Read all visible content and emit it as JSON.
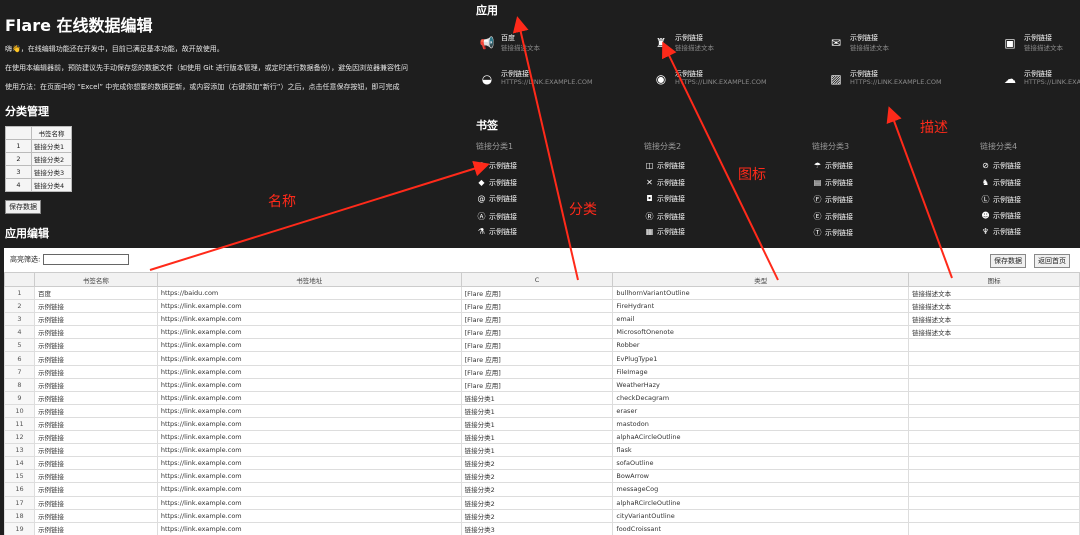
{
  "page": {
    "title": "Flare 在线数据编辑",
    "intro1": "嗨👋，在线编辑功能还在开发中，目前已满足基本功能，故开放使用。",
    "intro2": "在使用本编辑器前，预防建议先手动保存您的数据文件（如使用 Git 进行版本管理，或定时进行数据备份），避免因浏览器兼容性问",
    "intro3": "使用方法：在页面中的 “Excel” 中完成你想要的数据更新，或内容添加（右键添加“新行”）之后，点击任意保存按钮，即可完成"
  },
  "category_manage": {
    "title": "分类管理",
    "header": "书签名称",
    "rows": [
      {
        "idx": "1",
        "name": "链接分类1"
      },
      {
        "idx": "2",
        "name": "链接分类2"
      },
      {
        "idx": "3",
        "name": "链接分类3"
      },
      {
        "idx": "4",
        "name": "链接分类4"
      }
    ],
    "save_label": "保存数据"
  },
  "app_edit": {
    "title": "应用编辑"
  },
  "apps": {
    "title": "应用",
    "items": [
      {
        "name": "百度",
        "desc": "链接描述文本",
        "icon": "bullhorn-icon",
        "glyph": "📢"
      },
      {
        "name": "示例链接",
        "desc": "链接描述文本",
        "icon": "fire-hydrant-icon",
        "glyph": "♜"
      },
      {
        "name": "示例链接",
        "desc": "链接描述文本",
        "icon": "email-icon",
        "glyph": "✉"
      },
      {
        "name": "示例链接",
        "desc": "链接描述文本",
        "icon": "onenote-icon",
        "glyph": "▣"
      },
      {
        "name": "示例链接",
        "desc": "HTTPS://LINK.EXAMPLE.COM",
        "icon": "robber-icon",
        "glyph": "◒"
      },
      {
        "name": "示例链接",
        "desc": "HTTPS://LINK.EXAMPLE.COM",
        "icon": "plug-icon",
        "glyph": "◉"
      },
      {
        "name": "示例链接",
        "desc": "HTTPS://LINK.EXAMPLE.COM",
        "icon": "file-image-icon",
        "glyph": "▨"
      },
      {
        "name": "示例链接",
        "desc": "HTTPS://LINK.EXAMPLE.COM",
        "icon": "weather-hazy-icon",
        "glyph": "☁"
      }
    ]
  },
  "bookmarks": {
    "title": "书签",
    "columns": [
      {
        "name": "链接分类1",
        "items": [
          {
            "label": "示例链接",
            "glyph": "✺"
          },
          {
            "label": "示例链接",
            "glyph": "◆"
          },
          {
            "label": "示例链接",
            "glyph": "@"
          },
          {
            "label": "示例链接",
            "glyph": "Ⓐ"
          },
          {
            "label": "示例链接",
            "glyph": "⚗"
          }
        ]
      },
      {
        "name": "链接分类2",
        "items": [
          {
            "label": "示例链接",
            "glyph": "◫"
          },
          {
            "label": "示例链接",
            "glyph": "✕"
          },
          {
            "label": "示例链接",
            "glyph": "◘"
          },
          {
            "label": "示例链接",
            "glyph": "Ⓡ"
          },
          {
            "label": "示例链接",
            "glyph": "▦"
          }
        ]
      },
      {
        "name": "链接分类3",
        "items": [
          {
            "label": "示例链接",
            "glyph": "☂"
          },
          {
            "label": "示例链接",
            "glyph": "▤"
          },
          {
            "label": "示例链接",
            "glyph": "Ⓕ"
          },
          {
            "label": "示例链接",
            "glyph": "Ⓔ"
          },
          {
            "label": "示例链接",
            "glyph": "Ⓣ"
          }
        ]
      },
      {
        "name": "链接分类4",
        "items": [
          {
            "label": "示例链接",
            "glyph": "⊘"
          },
          {
            "label": "示例链接",
            "glyph": "♞"
          },
          {
            "label": "示例链接",
            "glyph": "Ⓛ"
          },
          {
            "label": "示例链接",
            "glyph": "☻"
          },
          {
            "label": "示例链接",
            "glyph": "♆"
          }
        ]
      }
    ]
  },
  "editor": {
    "filter_label": "高亮筛选:",
    "filter_value": "",
    "save_label": "保存数据",
    "home_label": "返回首页",
    "columns": [
      "书签名称",
      "书签地址",
      "C",
      "类型",
      "图标"
    ],
    "rows": [
      [
        "1",
        "百度",
        "https://baidu.com",
        "[Flare 应用]",
        "bullhornVariantOutline",
        "链接描述文本"
      ],
      [
        "2",
        "示例链接",
        "https://link.example.com",
        "[Flare 应用]",
        "FireHydrant",
        "链接描述文本"
      ],
      [
        "3",
        "示例链接",
        "https://link.example.com",
        "[Flare 应用]",
        "email",
        "链接描述文本"
      ],
      [
        "4",
        "示例链接",
        "https://link.example.com",
        "[Flare 应用]",
        "MicrosoftOnenote",
        "链接描述文本"
      ],
      [
        "5",
        "示例链接",
        "https://link.example.com",
        "[Flare 应用]",
        "Robber",
        ""
      ],
      [
        "6",
        "示例链接",
        "https://link.example.com",
        "[Flare 应用]",
        "EvPlugType1",
        ""
      ],
      [
        "7",
        "示例链接",
        "https://link.example.com",
        "[Flare 应用]",
        "FileImage",
        ""
      ],
      [
        "8",
        "示例链接",
        "https://link.example.com",
        "[Flare 应用]",
        "WeatherHazy",
        ""
      ],
      [
        "9",
        "示例链接",
        "https://link.example.com",
        "链接分类1",
        "checkDecagram",
        ""
      ],
      [
        "10",
        "示例链接",
        "https://link.example.com",
        "链接分类1",
        "eraser",
        ""
      ],
      [
        "11",
        "示例链接",
        "https://link.example.com",
        "链接分类1",
        "mastodon",
        ""
      ],
      [
        "12",
        "示例链接",
        "https://link.example.com",
        "链接分类1",
        "alphaACircleOutline",
        ""
      ],
      [
        "13",
        "示例链接",
        "https://link.example.com",
        "链接分类1",
        "flask",
        ""
      ],
      [
        "14",
        "示例链接",
        "https://link.example.com",
        "链接分类2",
        "sofaOutline",
        ""
      ],
      [
        "15",
        "示例链接",
        "https://link.example.com",
        "链接分类2",
        "BowArrow",
        ""
      ],
      [
        "16",
        "示例链接",
        "https://link.example.com",
        "链接分类2",
        "messageCog",
        ""
      ],
      [
        "17",
        "示例链接",
        "https://link.example.com",
        "链接分类2",
        "alphaRCircleOutline",
        ""
      ],
      [
        "18",
        "示例链接",
        "https://link.example.com",
        "链接分类2",
        "cityVariantOutline",
        ""
      ],
      [
        "19",
        "示例链接",
        "https://link.example.com",
        "链接分类3",
        "foodCroissant",
        ""
      ]
    ]
  },
  "annotations": {
    "color": "#ff2a1a",
    "name_label": "名称",
    "category_label": "分类",
    "icon_label": "图标",
    "desc_label": "描述"
  }
}
